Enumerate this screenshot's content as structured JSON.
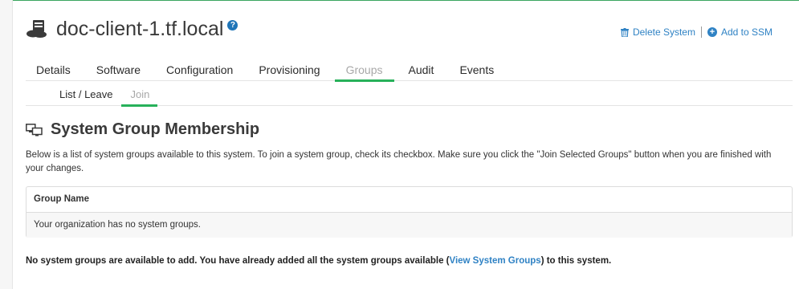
{
  "header": {
    "title": "doc-client-1.tf.local",
    "icon": "system-icon",
    "help_icon": "help-icon",
    "delete_label": "Delete System",
    "add_ssm_label": "Add to SSM"
  },
  "tabs": [
    {
      "label": "Details",
      "active": false
    },
    {
      "label": "Software",
      "active": false
    },
    {
      "label": "Configuration",
      "active": false
    },
    {
      "label": "Provisioning",
      "active": false
    },
    {
      "label": "Groups",
      "active": true
    },
    {
      "label": "Audit",
      "active": false
    },
    {
      "label": "Events",
      "active": false
    }
  ],
  "subtabs": [
    {
      "label": "List / Leave",
      "active": false
    },
    {
      "label": "Join",
      "active": true
    }
  ],
  "section": {
    "title": "System Group Membership",
    "description": "Below is a list of system groups available to this system. To join a system group, check its checkbox. Make sure you click the \"Join Selected Groups\" button when you are finished with your changes."
  },
  "table": {
    "header": "Group Name",
    "empty_message": "Your organization has no system groups."
  },
  "note": {
    "before": "No system groups are available to add. You have already added all the system groups available (",
    "link": "View System Groups",
    "after": ") to this system."
  },
  "colors": {
    "accent_green": "#27b15a",
    "link_blue": "#2f82c4"
  }
}
